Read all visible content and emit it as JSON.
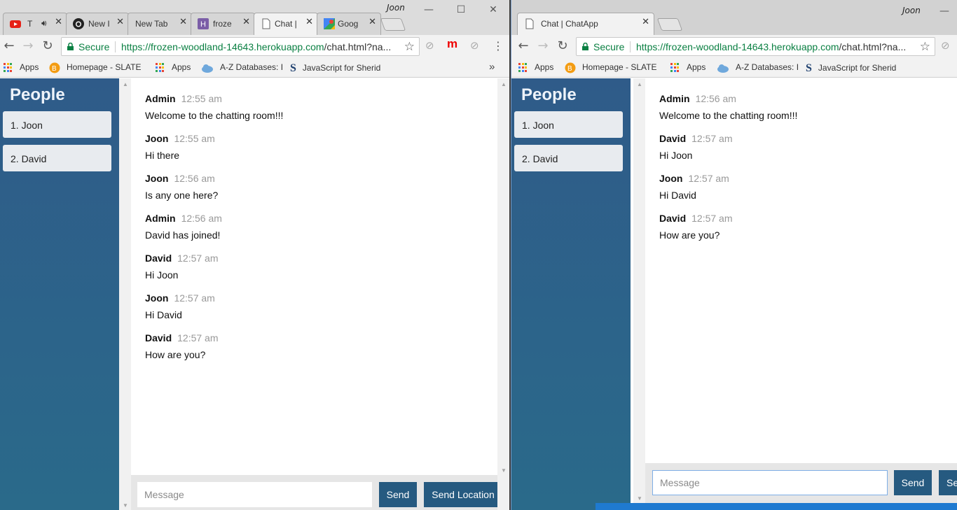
{
  "left_window": {
    "profile": "Joon",
    "controls": {
      "minimize": "—",
      "maximize": "☐",
      "close": "✕"
    },
    "tabs": [
      {
        "label": "T",
        "icon": "youtube-icon",
        "audio": true
      },
      {
        "label": "New I",
        "icon": "github-icon"
      },
      {
        "label": "New Tab",
        "icon": ""
      },
      {
        "label": "froze",
        "icon": "heroku-icon"
      },
      {
        "label": "Chat |",
        "icon": "page-icon",
        "active": true
      },
      {
        "label": "Goog",
        "icon": "maps-icon"
      }
    ],
    "omnibox": {
      "secure": "Secure",
      "url_host": "https://frozen-woodland-14643.herokuapp.com",
      "url_rest": "/chat.html?na..."
    },
    "bookmarks": [
      "Apps",
      "Homepage - SLATE",
      "Apps",
      "A-Z Databases: I",
      "JavaScript for Sherid"
    ],
    "people_title": "People",
    "people": [
      "1. Joon",
      "2. David"
    ],
    "messages": [
      {
        "from": "Admin",
        "time": "12:55 am",
        "text": "Welcome to the chatting room!!!"
      },
      {
        "from": "Joon",
        "time": "12:55 am",
        "text": "Hi there"
      },
      {
        "from": "Joon",
        "time": "12:56 am",
        "text": "Is any one here?"
      },
      {
        "from": "Admin",
        "time": "12:56 am",
        "text": "David has joined!"
      },
      {
        "from": "David",
        "time": "12:57 am",
        "text": "Hi Joon"
      },
      {
        "from": "Joon",
        "time": "12:57 am",
        "text": "Hi David"
      },
      {
        "from": "David",
        "time": "12:57 am",
        "text": "How are you?"
      }
    ],
    "footer": {
      "placeholder": "Message",
      "send": "Send",
      "send_location": "Send Location"
    }
  },
  "right_window": {
    "profile": "Joon",
    "controls": {
      "minimize": "—"
    },
    "tabs": [
      {
        "label": "Chat | ChatApp",
        "icon": "page-icon",
        "active": true
      }
    ],
    "omnibox": {
      "secure": "Secure",
      "url_host": "https://frozen-woodland-14643.herokuapp.com",
      "url_rest": "/chat.html?na..."
    },
    "bookmarks": [
      "Apps",
      "Homepage - SLATE",
      "Apps",
      "A-Z Databases: I",
      "JavaScript for Sherid"
    ],
    "people_title": "People",
    "people": [
      "1. Joon",
      "2. David"
    ],
    "messages": [
      {
        "from": "Admin",
        "time": "12:56 am",
        "text": "Welcome to the chatting room!!!"
      },
      {
        "from": "David",
        "time": "12:57 am",
        "text": "Hi Joon"
      },
      {
        "from": "Joon",
        "time": "12:57 am",
        "text": "Hi David"
      },
      {
        "from": "David",
        "time": "12:57 am",
        "text": "How are you?"
      }
    ],
    "footer": {
      "placeholder": "Message",
      "send": "Send",
      "send_location": "Se"
    }
  },
  "colors": {
    "sidebar_top": "#2f5b89",
    "sidebar_bottom": "#2a6a8a",
    "button": "#265a80",
    "secure_green": "#0b8043"
  }
}
